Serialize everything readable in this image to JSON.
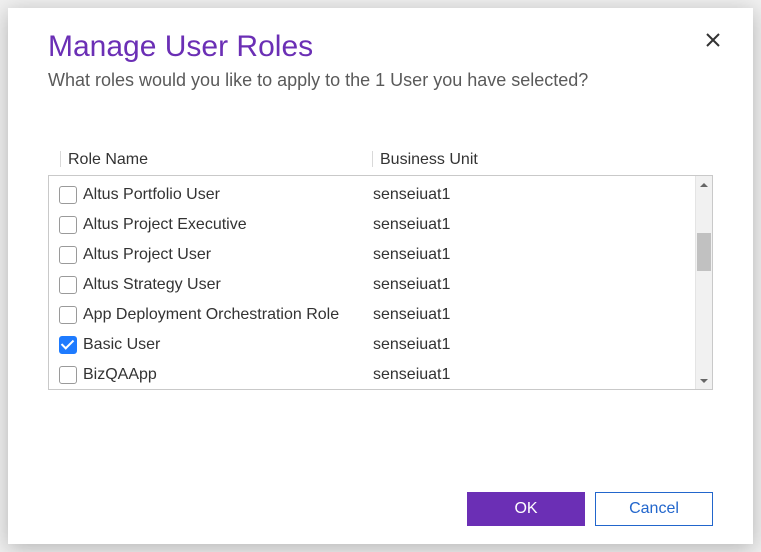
{
  "dialog": {
    "title": "Manage User Roles",
    "subtitle": "What roles would you like to apply to the 1 User you have selected?",
    "columns": {
      "role": "Role Name",
      "bu": "Business Unit"
    },
    "rows": [
      {
        "role": "Altus Portfolio User",
        "bu": "senseiuat1",
        "checked": false
      },
      {
        "role": "Altus Project Executive",
        "bu": "senseiuat1",
        "checked": false
      },
      {
        "role": "Altus Project User",
        "bu": "senseiuat1",
        "checked": false
      },
      {
        "role": "Altus Strategy User",
        "bu": "senseiuat1",
        "checked": false
      },
      {
        "role": "App Deployment Orchestration Role",
        "bu": "senseiuat1",
        "checked": false
      },
      {
        "role": "Basic User",
        "bu": "senseiuat1",
        "checked": true
      },
      {
        "role": "BizQAApp",
        "bu": "senseiuat1",
        "checked": false
      }
    ],
    "buttons": {
      "ok": "OK",
      "cancel": "Cancel"
    }
  }
}
